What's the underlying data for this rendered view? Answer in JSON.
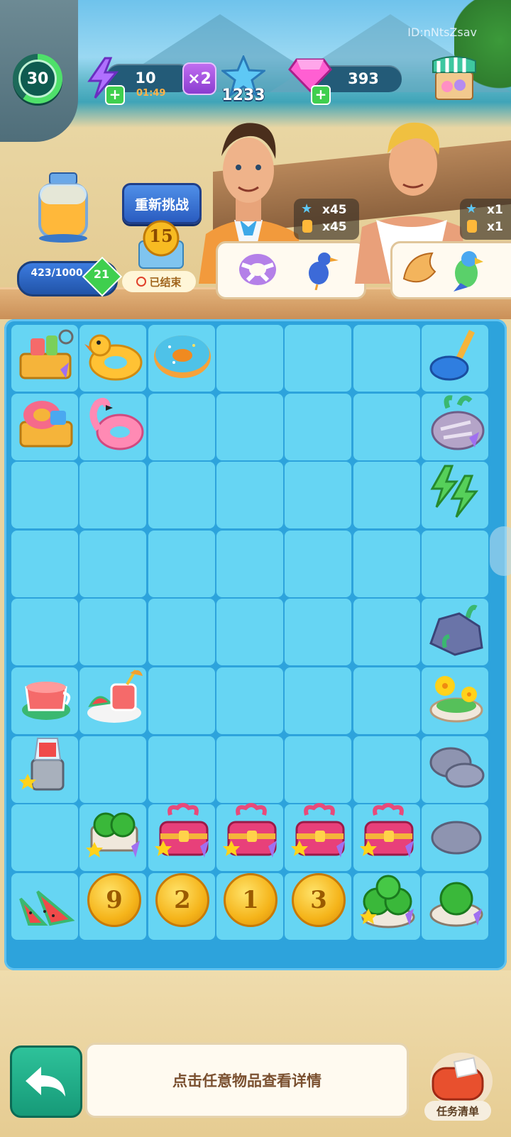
{
  "header": {
    "player_id": "ID:nNtsZsav",
    "level": "30",
    "energy": {
      "value": "10",
      "timer": "01:49",
      "multiplier": "×2",
      "plus": "+"
    },
    "stars": "1233",
    "gems": {
      "value": "393",
      "plus": "+"
    }
  },
  "left_panel": {
    "jar_progress": "423/1000",
    "jar_level": "21",
    "retry_button": "重新挑战",
    "coin_value": "15",
    "ended_label": "已结束"
  },
  "customers": [
    {
      "rewards": [
        "x45",
        "x45"
      ]
    },
    {
      "rewards": [
        "x1",
        "x1"
      ]
    }
  ],
  "board": {
    "coins": [
      "9",
      "2",
      "1",
      "3"
    ]
  },
  "footer": {
    "hint": "点击任意物品查看详情",
    "task_list": "任务清单"
  },
  "colors": {
    "board": "#2da3dc",
    "cell": "#66d5f3",
    "accent_green": "#3fcf4e",
    "accent_purple": "#8a3cd0"
  }
}
